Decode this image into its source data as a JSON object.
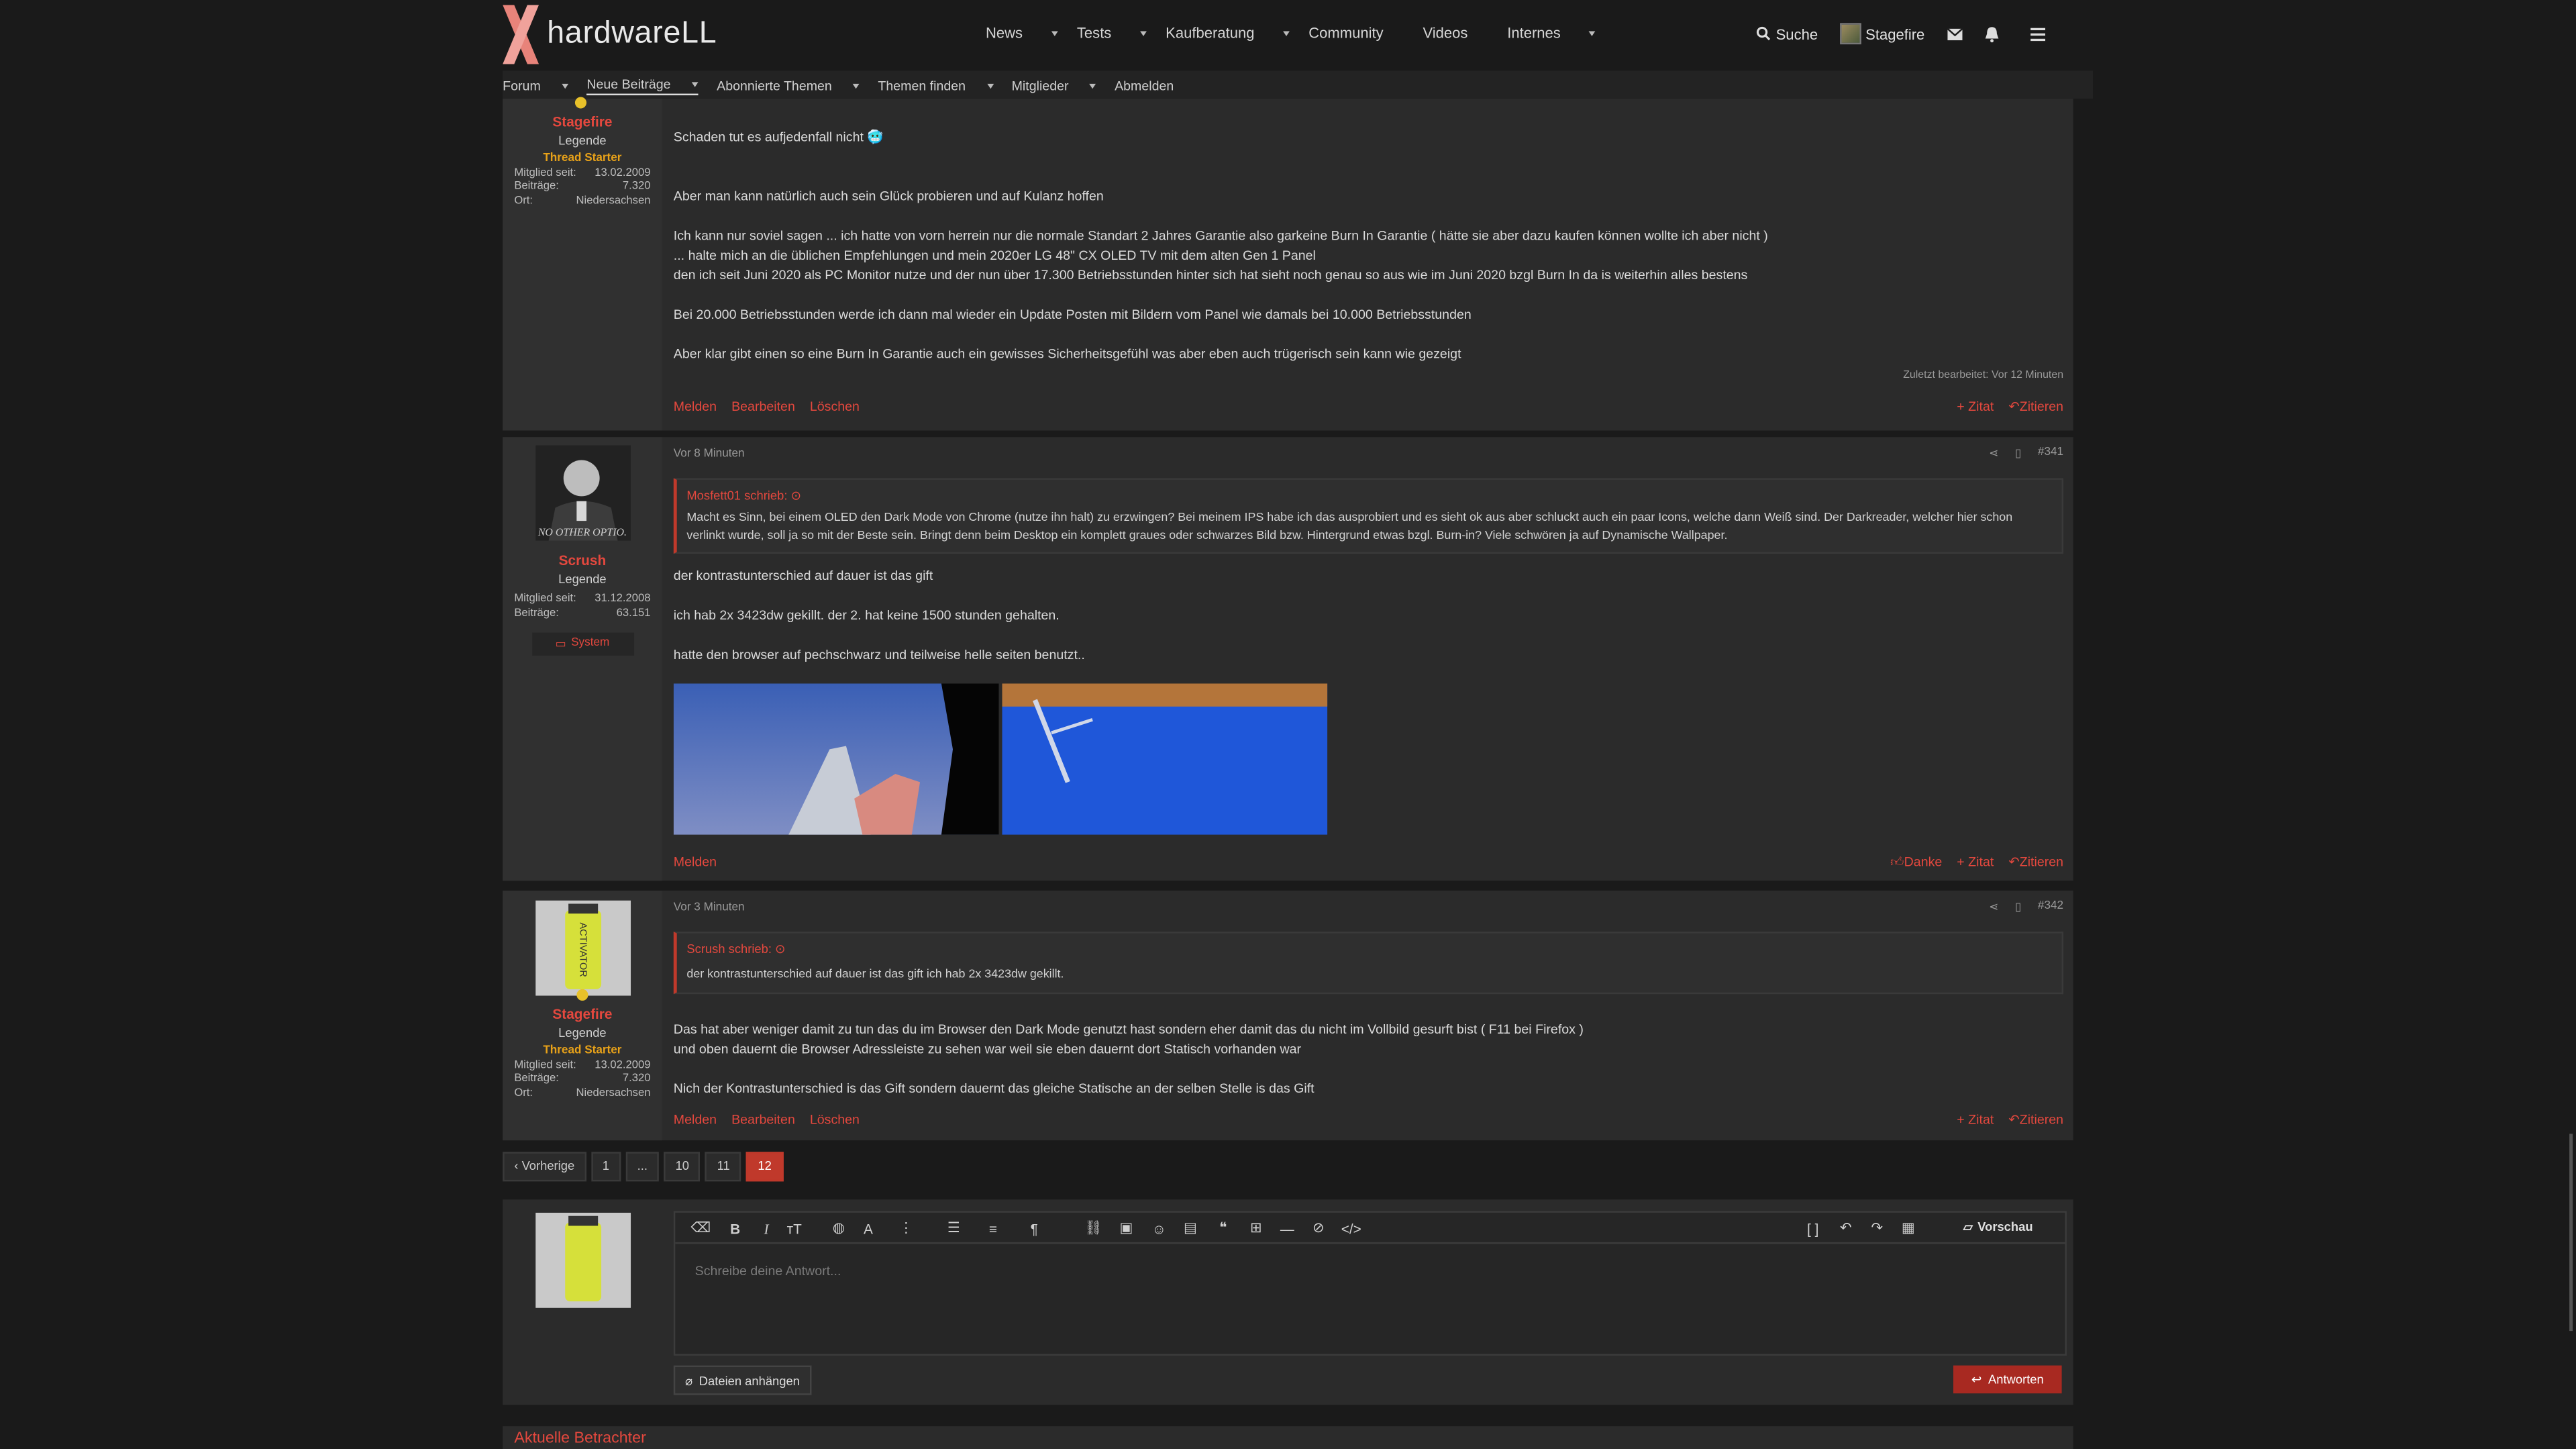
{
  "header": {
    "logo_text": "hardwareLL",
    "nav": [
      "News",
      "Tests",
      "Kaufberatung",
      "Community",
      "Videos",
      "Internes"
    ],
    "nav_has_dropdown": [
      true,
      true,
      true,
      false,
      false,
      true
    ],
    "search_label": "Suche",
    "user_label": "Stagefire"
  },
  "subnav": {
    "items": [
      "Forum",
      "Neue Beiträge",
      "Abonnierte Themen",
      "Themen finden",
      "Mitglieder",
      "Abmelden"
    ]
  },
  "post340": {
    "user": {
      "name": "Stagefire",
      "role": "Legende",
      "starter": "Thread Starter",
      "stats": [
        {
          "k": "Mitglied seit:",
          "v": "13.02.2009"
        },
        {
          "k": "Beiträge:",
          "v": "7.320"
        },
        {
          "k": "Ort:",
          "v": "Niedersachsen"
        }
      ]
    },
    "lines": [
      "Schaden tut es aufjedenfall nicht 🥶",
      "Aber man kann natürlich auch sein Glück probieren und auf Kulanz hoffen",
      "Ich kann nur soviel sagen ... ich hatte von vorn herrein nur die normale Standart 2 Jahres Garantie also garkeine Burn In Garantie ( hätte sie aber dazu kaufen können wollte ich aber nicht )",
      "... halte mich an die üblichen Empfehlungen und mein 2020er LG 48\" CX OLED TV mit dem alten Gen 1 Panel",
      "den ich seit Juni 2020 als PC Monitor nutze und der nun über 17.300 Betriebsstunden hinter sich hat sieht noch genau so aus wie im Juni 2020 bzgl Burn In da is weiterhin alles bestens",
      "Bei 20.000 Betriebsstunden werde ich dann mal wieder ein Update Posten mit Bildern vom Panel wie damals bei 10.000 Betriebsstunden",
      "Aber klar gibt einen so eine Burn In Garantie auch ein gewisses Sicherheitsgefühl was aber eben auch trügerisch sein kann wie gezeigt"
    ],
    "edited": "Zuletzt bearbeitet: Vor 12 Minuten",
    "actions_left": [
      "Melden",
      "Bearbeiten",
      "Löschen"
    ],
    "actions_right": [
      "+ Zitat",
      "Zitieren"
    ]
  },
  "post341": {
    "time": "Vor 8 Minuten",
    "number": "#341",
    "user": {
      "name": "Scrush",
      "role": "Legende",
      "avatar_caption": "NO OTHER OPTIO.",
      "stats": [
        {
          "k": "Mitglied seit:",
          "v": "31.12.2008"
        },
        {
          "k": "Beiträge:",
          "v": "63.151"
        }
      ],
      "system": "System"
    },
    "quote_author": "Mosfett01 schrieb:",
    "quote_text": "Macht es Sinn, bei einem OLED den Dark Mode von Chrome (nutze ihn halt) zu erzwingen? Bei meinem IPS habe ich das ausprobiert und es sieht ok aus aber schluckt auch ein paar Icons, welche dann Weiß sind. Der Darkreader, welcher hier schon verlinkt wurde, soll ja so mit der Beste sein. Bringt denn beim Desktop ein komplett graues oder schwarzes Bild bzw. Hintergrund etwas bzgl. Burn-in? Viele schwören ja auf Dynamische Wallpaper.",
    "lines": [
      "der kontrastunterschied auf dauer ist das gift",
      "ich hab 2x 3423dw gekillt. der 2. hat keine 1500 stunden gehalten.",
      "hatte den browser auf pechschwarz und teilweise helle seiten benutzt.."
    ],
    "actions_left": [
      "Melden"
    ],
    "actions_right": [
      "Danke",
      "+ Zitat",
      "Zitieren"
    ]
  },
  "post342": {
    "time": "Vor 3 Minuten",
    "number": "#342",
    "user": {
      "name": "Stagefire",
      "role": "Legende",
      "starter": "Thread Starter",
      "stats": [
        {
          "k": "Mitglied seit:",
          "v": "13.02.2009"
        },
        {
          "k": "Beiträge:",
          "v": "7.320"
        },
        {
          "k": "Ort:",
          "v": "Niedersachsen"
        }
      ]
    },
    "quote_author": "Scrush schrieb:",
    "quote_text": "der kontrastunterschied auf dauer ist das gift ich hab 2x 3423dw gekillt.",
    "lines": [
      "Das hat aber weniger damit zu tun das du im Browser den Dark Mode genutzt hast sondern eher damit das du nicht im Vollbild gesurft bist ( F11 bei Firefox )",
      "und oben dauernt die Browser Adressleiste zu sehen war weil sie eben dauernt dort Statisch vorhanden war",
      "Nich der Kontrastunterschied is das Gift sondern dauernt das gleiche Statische an der selben Stelle is das Gift"
    ],
    "actions_left": [
      "Melden",
      "Bearbeiten",
      "Löschen"
    ],
    "actions_right": [
      "+ Zitat",
      "Zitieren"
    ]
  },
  "pager": {
    "prev": "Vorherige",
    "pages": [
      "1",
      "...",
      "10",
      "11",
      "12"
    ],
    "current": "12"
  },
  "editor": {
    "placeholder": "Schreibe deine Antwort...",
    "preview": "Vorschau",
    "attach": "Dateien anhängen",
    "reply": "Antworten"
  },
  "viewers_title": "Aktuelle Betrachter",
  "colors": {
    "accent": "#e4483e",
    "starter": "#e8a219",
    "bg": "#1a1a1a",
    "panel": "#2b2b2b"
  }
}
